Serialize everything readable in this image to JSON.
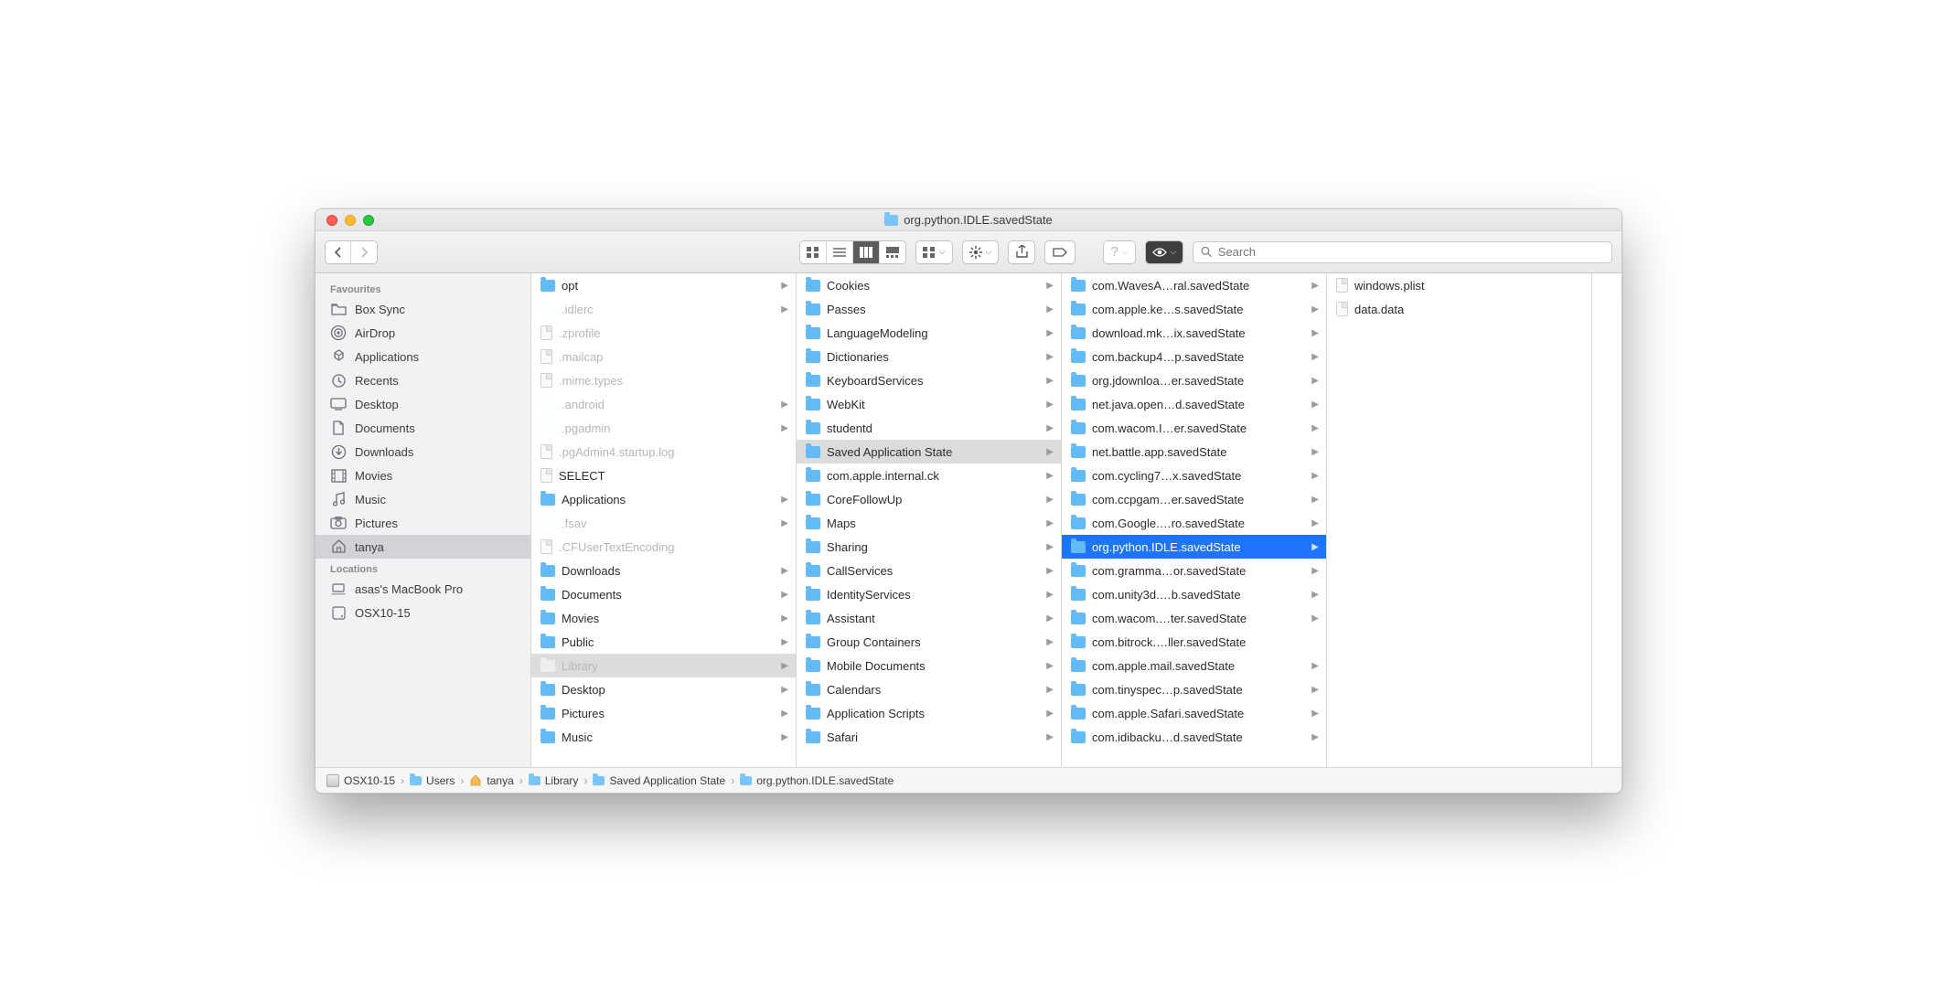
{
  "window": {
    "title": "org.python.IDLE.savedState"
  },
  "search": {
    "placeholder": "Search"
  },
  "sidebar": {
    "sections": [
      {
        "title": "Favourites",
        "items": [
          {
            "icon": "folder-icon",
            "label": "Box Sync"
          },
          {
            "icon": "airdrop-icon",
            "label": "AirDrop"
          },
          {
            "icon": "apps-icon",
            "label": "Applications"
          },
          {
            "icon": "recents-icon",
            "label": "Recents"
          },
          {
            "icon": "desktop-icon",
            "label": "Desktop"
          },
          {
            "icon": "documents-icon",
            "label": "Documents"
          },
          {
            "icon": "downloads-icon",
            "label": "Downloads"
          },
          {
            "icon": "movies-icon",
            "label": "Movies"
          },
          {
            "icon": "music-icon",
            "label": "Music"
          },
          {
            "icon": "pictures-icon",
            "label": "Pictures"
          },
          {
            "icon": "home-icon",
            "label": "tanya",
            "selected": true
          }
        ]
      },
      {
        "title": "Locations",
        "items": [
          {
            "icon": "laptop-icon",
            "label": "asas's MacBook Pro"
          },
          {
            "icon": "disk-icon",
            "label": "OSX10-15"
          }
        ]
      }
    ]
  },
  "columns": [
    [
      {
        "t": "folder",
        "name": "opt",
        "arrow": true
      },
      {
        "t": "folder",
        "name": ".idlerc",
        "dim": true,
        "light": true,
        "arrow": true
      },
      {
        "t": "file",
        "name": ".zprofile",
        "dim": true
      },
      {
        "t": "file",
        "name": ".mailcap",
        "dim": true
      },
      {
        "t": "file",
        "name": ".mime.types",
        "dim": true
      },
      {
        "t": "folder",
        "name": ".android",
        "dim": true,
        "light": true,
        "arrow": true
      },
      {
        "t": "folder",
        "name": ".pgadmin",
        "dim": true,
        "light": true,
        "arrow": true
      },
      {
        "t": "file",
        "name": ".pgAdmin4.startup.log",
        "dim": true
      },
      {
        "t": "file",
        "name": "SELECT"
      },
      {
        "t": "folder",
        "name": "Applications",
        "arrow": true
      },
      {
        "t": "folder",
        "name": ".fsav",
        "dim": true,
        "light": true,
        "arrow": true
      },
      {
        "t": "file",
        "name": ".CFUserTextEncoding",
        "dim": true
      },
      {
        "t": "folder",
        "name": "Downloads",
        "arrow": true
      },
      {
        "t": "folder",
        "name": "Documents",
        "arrow": true
      },
      {
        "t": "folder",
        "name": "Movies",
        "arrow": true
      },
      {
        "t": "folder",
        "name": "Public",
        "arrow": true
      },
      {
        "t": "folder",
        "name": "Library",
        "dim": true,
        "light": true,
        "arrow": true,
        "sel": "grey"
      },
      {
        "t": "folder",
        "name": "Desktop",
        "arrow": true
      },
      {
        "t": "folder",
        "name": "Pictures",
        "arrow": true
      },
      {
        "t": "folder",
        "name": "Music",
        "arrow": true
      }
    ],
    [
      {
        "t": "folder",
        "name": "Cookies",
        "arrow": true
      },
      {
        "t": "folder",
        "name": "Passes",
        "arrow": true
      },
      {
        "t": "folder",
        "name": "LanguageModeling",
        "arrow": true
      },
      {
        "t": "folder",
        "name": "Dictionaries",
        "arrow": true
      },
      {
        "t": "folder",
        "name": "KeyboardServices",
        "arrow": true
      },
      {
        "t": "folder",
        "name": "WebKit",
        "arrow": true
      },
      {
        "t": "folder",
        "name": "studentd",
        "arrow": true
      },
      {
        "t": "folder",
        "name": "Saved Application State",
        "arrow": true,
        "sel": "grey"
      },
      {
        "t": "folder",
        "name": "com.apple.internal.ck",
        "arrow": true
      },
      {
        "t": "folder",
        "name": "CoreFollowUp",
        "arrow": true
      },
      {
        "t": "folder",
        "name": "Maps",
        "arrow": true
      },
      {
        "t": "folder",
        "name": "Sharing",
        "arrow": true
      },
      {
        "t": "folder",
        "name": "CallServices",
        "arrow": true
      },
      {
        "t": "folder",
        "name": "IdentityServices",
        "arrow": true
      },
      {
        "t": "folder",
        "name": "Assistant",
        "arrow": true
      },
      {
        "t": "folder",
        "name": "Group Containers",
        "arrow": true
      },
      {
        "t": "folder",
        "name": "Mobile Documents",
        "arrow": true
      },
      {
        "t": "folder",
        "name": "Calendars",
        "arrow": true
      },
      {
        "t": "folder",
        "name": "Application Scripts",
        "arrow": true
      },
      {
        "t": "folder",
        "name": "Safari",
        "arrow": true
      }
    ],
    [
      {
        "t": "folder",
        "name": "com.WavesA…ral.savedState",
        "arrow": true
      },
      {
        "t": "folder",
        "name": "com.apple.ke…s.savedState",
        "arrow": true
      },
      {
        "t": "folder",
        "name": "download.mk…ix.savedState",
        "arrow": true
      },
      {
        "t": "folder",
        "name": "com.backup4…p.savedState",
        "arrow": true
      },
      {
        "t": "folder",
        "name": "org.jdownloa…er.savedState",
        "arrow": true
      },
      {
        "t": "folder",
        "name": "net.java.open…d.savedState",
        "arrow": true
      },
      {
        "t": "folder",
        "name": "com.wacom.I…er.savedState",
        "arrow": true
      },
      {
        "t": "folder",
        "name": "net.battle.app.savedState",
        "arrow": true
      },
      {
        "t": "folder",
        "name": "com.cycling7…x.savedState",
        "arrow": true
      },
      {
        "t": "folder",
        "name": "com.ccpgam…er.savedState",
        "arrow": true
      },
      {
        "t": "folder",
        "name": "com.Google.…ro.savedState",
        "arrow": true
      },
      {
        "t": "folder",
        "name": "org.python.IDLE.savedState",
        "arrow": true,
        "sel": "blue"
      },
      {
        "t": "folder",
        "name": "com.gramma…or.savedState",
        "arrow": true
      },
      {
        "t": "folder",
        "name": "com.unity3d.…b.savedState",
        "arrow": true
      },
      {
        "t": "folder",
        "name": "com.wacom.…ter.savedState",
        "arrow": true
      },
      {
        "t": "folder",
        "name": "com.bitrock.…ller.savedState"
      },
      {
        "t": "folder",
        "name": "com.apple.mail.savedState",
        "arrow": true
      },
      {
        "t": "folder",
        "name": "com.tinyspec…p.savedState",
        "arrow": true
      },
      {
        "t": "folder",
        "name": "com.apple.Safari.savedState",
        "arrow": true
      },
      {
        "t": "folder",
        "name": "com.idibacku…d.savedState",
        "arrow": true
      }
    ],
    [
      {
        "t": "file",
        "name": "windows.plist"
      },
      {
        "t": "file",
        "name": "data.data"
      }
    ]
  ],
  "path": [
    {
      "icon": "disk",
      "label": "OSX10-15"
    },
    {
      "icon": "folder",
      "label": "Users"
    },
    {
      "icon": "home",
      "label": "tanya"
    },
    {
      "icon": "folder",
      "label": "Library"
    },
    {
      "icon": "folder",
      "label": "Saved Application State"
    },
    {
      "icon": "folder",
      "label": "org.python.IDLE.savedState"
    }
  ]
}
